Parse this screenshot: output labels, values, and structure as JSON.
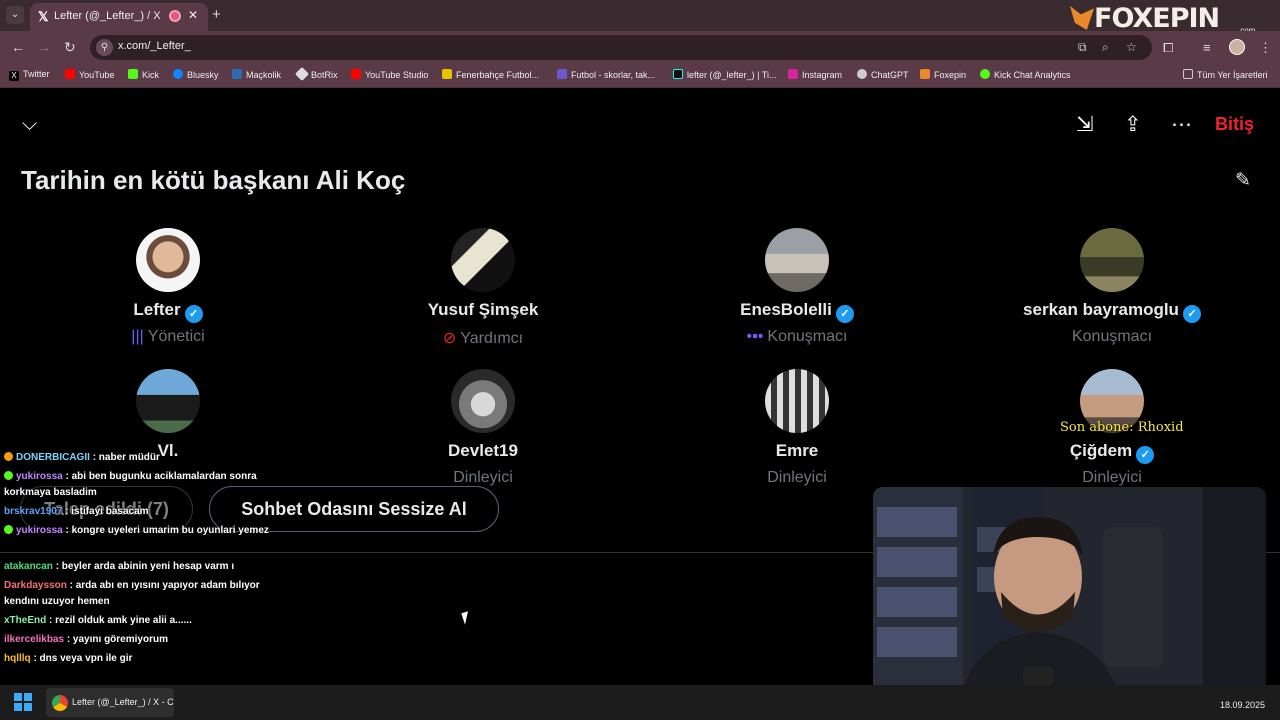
{
  "browser": {
    "tab_title": "Lefter (@_Lefter_) / X",
    "url": "x.com/_Lefter_",
    "brand_logo_text": "FOXEPIN",
    "brand_logo_sub": ".com",
    "bookmarks": [
      "Twitter",
      "YouTube",
      "Kick",
      "Bluesky",
      "Maçkolik",
      "BotRix",
      "YouTube Studio",
      "Fenerbahçe Futbol...",
      "Futbol - skorlar, tak...",
      "lefter (@_lefter_) | Ti...",
      "Instagram",
      "ChatGPT",
      "Foxepin",
      "Kick Chat Analytics"
    ],
    "all_bookmarks": "Tüm Yer İşaretleri"
  },
  "space": {
    "title": "Tarihin en kötü başkanı Ali Koç",
    "end_label": "Bitiş",
    "participants": [
      {
        "name": "Lefter",
        "role": "Yönetici",
        "verified": true
      },
      {
        "name": "Yusuf Şimşek",
        "role": "Yardımcı",
        "verified": false
      },
      {
        "name": "EnesBolelli",
        "role": "Konuşmacı",
        "verified": true
      },
      {
        "name": "serkan bayramoglu",
        "role": "Konuşmacı",
        "verified": true
      },
      {
        "name": "Vl.",
        "role": "",
        "verified": false
      },
      {
        "name": "Devlet19",
        "role": "Dinleyici",
        "verified": false
      },
      {
        "name": "Emre",
        "role": "Dinleyici",
        "verified": false
      },
      {
        "name": "Çiğdem",
        "role": "Dinleyici",
        "verified": true
      }
    ],
    "requests_label": "Talep edildi (7)",
    "mute_label": "Sohbet Odasını Sessize Al"
  },
  "chat": [
    {
      "user": "DONERBICAGII",
      "color": "#7dd3fc",
      "text": ": naber müdür"
    },
    {
      "user": "yukirossa",
      "color": "#c084fc",
      "text": ": abi ben bugunku aciklamalardan sonra korkmaya basladim"
    },
    {
      "user": "brskrav1907",
      "color": "#60a5fa",
      "text": ": istifayi basacam"
    },
    {
      "user": "yukirossa",
      "color": "#c084fc",
      "text": ": kongre uyeleri umarim bu oyunlari yemez"
    },
    {
      "user": "atakancan",
      "color": "#4ade80",
      "text": ": beyler arda abinin yeni hesap varm ı"
    },
    {
      "user": "Darkdaysson",
      "color": "#f87171",
      "text": ": arda abı en ıyısını yapıyor adam bılıyor kendını uzuyor hemen"
    },
    {
      "user": "xTheEnd",
      "color": "#86efac",
      "text": ": rezil olduk amk yine alii a......"
    },
    {
      "user": "ilkercelikbas",
      "color": "#f472b6",
      "text": ": yayını göremiyorum"
    },
    {
      "user": "hqlllq",
      "color": "#fbbf24",
      "text": ": dns veya vpn ile gir"
    }
  ],
  "alert": "Son abone: Rhoxid",
  "taskbar": {
    "app_label": "Lefter (@_Lefter_) / X - C",
    "date": "18.09.2025"
  }
}
